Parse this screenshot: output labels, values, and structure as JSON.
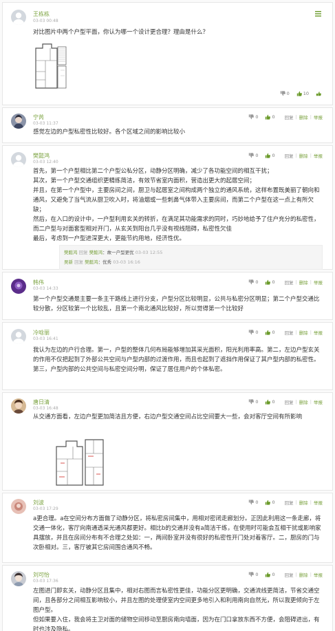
{
  "question": {
    "user": "王栋栋",
    "date": "03-03 00:48",
    "text": "对比图片中两个户型平面，你认为哪一个设计更合理？理由是什么？",
    "likes": "0",
    "comments": "10"
  },
  "labels": {
    "reply": "回复",
    "delete": "删除",
    "report": "举报"
  },
  "answers": [
    {
      "user": "宁芮",
      "date": "03-03 11:37",
      "likes": "0",
      "dislikes": "0",
      "text": [
        "感觉左边的户型私密性比较好。各个区域之间的影响比较小"
      ]
    },
    {
      "user": "樊懿鸿",
      "date": "03-03 12:40",
      "likes": "0",
      "dislikes": "0",
      "text": [
        "首先，第一个户型相比第二个户型公私分区，动静分区明确，减少了各功能空间的相互干扰；",
        "其次，第一个户型交通组织更精练简洁，有效节省室内面积，营造出更大的起居空间；",
        "并且，在第一个户型中，主要房间之间，厨卫与起居室之间构成两个独立的通风系统，这样布置既美丽了朝向和通风，又避免了当气流从厨卫吹入时，将油烟或一些刺鼻气体带入主要房间，而第二个户型在这一点上有所欠缺；",
        "然后，在入口的设计中，一户型利用玄关的转折，在满足其功能需求的同时，巧妙地给予了住户充分的私密性，而二户型与对面套型相对开门，从玄关到阳台几乎没有视线阻碍，私密性欠佳",
        "最后，考虑到一户型进深更大，更能节约用地，经济性优。"
      ],
      "replies": [
        {
          "name": "樊懿鸿",
          "verb": "回复",
          "target": "樊懿鸿",
          "text": "：故一户型更优",
          "date": "03-03 12:55"
        },
        {
          "name": "吴新",
          "verb": "回复",
          "target": "樊懿鸿",
          "text": "：优秀",
          "date": "03-03 16:16"
        }
      ]
    },
    {
      "user": "韩伟",
      "date": "03-03 14:33",
      "likes": "0",
      "dislikes": "0",
      "text": [
        "第一个户型交通是主要一条主干路线上进行分支，户型分区比较明显，公共与私密分区明显；第二个户型交通比较分散，分区较第一个比较乱，且第一个南北通风比较好，所以觉得第一个比较好"
      ]
    },
    {
      "user": "冷晗丽",
      "date": "03-03 16:41",
      "likes": "0",
      "dislikes": "0",
      "text": [
        "我认为左边的户行合理。第一，户型的整体几何布局能够增加其采光面积，阳光利用率高。第二，左边户型玄关的作用不仅把起到了外部公共空间与户型内部的过渡作用，而且也起到了遮挡作用保证了其户型内部的私密性。第三，户型内部的公共空间与私密空间分明，保证了居住用户的个体私密。"
      ]
    },
    {
      "user": "唐日清",
      "date": "03-03 16:48",
      "likes": "0",
      "dislikes": "0",
      "text": [
        "从交通方面看，左边户型更加简洁且方便，右边户型交通空间占比空间要大一些，会对客厅空间有所影响"
      ]
    },
    {
      "user": "刘波",
      "date": "03-03 17:29",
      "likes": "0",
      "dislikes": "0",
      "text": [
        "a更合理。a在空间分布方面做了动静分区，将私密房间集中，用相对密闭走廊划分。正因此利用这一条走廊，将交通一体化，客厅向南通透采光通风都更好。相比b的交通并没有a简洁干练，在使用时可能会互相干扰或影响家具摆放，并且在房间分布有不合理之处如：一，两间卧室并没有很好的私密性开门处对着客厅。二，厨房的门与次卧相对。三，客厅被其它房间围合通风不畅。"
      ]
    },
    {
      "user": "刘可怡",
      "date": "03-03 17:36",
      "likes": "0",
      "dislikes": "0",
      "text": [
        "左图进门即玄关，动静分区且集中，相对右图而言私密性更佳，功能分区更明确，交通流线更简洁，节省交通空间，且各部分之间相互影响较小，并且左图的处理使室内空间更多地引入和利用南向自然光，所以我更倾向于左图户型。",
        "但如果要入住，我会将主卫对面的储物空间移动至厨房南向墙面，因为在门口拿放东西不方便，会阻碍进出，有时也涉及隐私。"
      ]
    }
  ]
}
